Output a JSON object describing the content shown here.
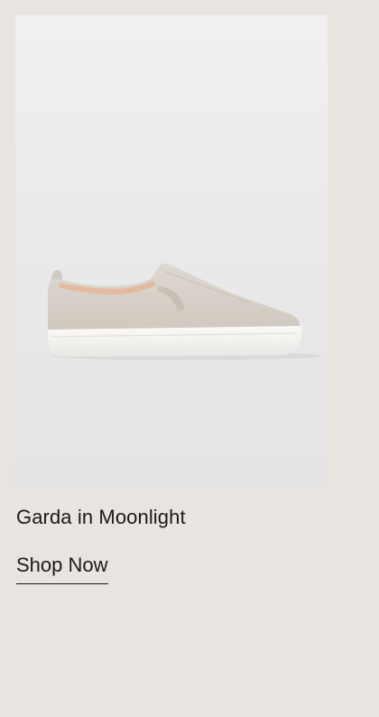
{
  "product": {
    "name": "Garda in Moonlight",
    "image_alt": "Garda in Moonlight slip-on sneaker",
    "cta_label": "Shop Now"
  },
  "colors": {
    "page_background": "#e8e4e0",
    "card_background": "#ececec",
    "shoe_upper": "#d6d0c8",
    "shoe_sole": "#f5f4f1",
    "text": "#1a1a1a"
  }
}
